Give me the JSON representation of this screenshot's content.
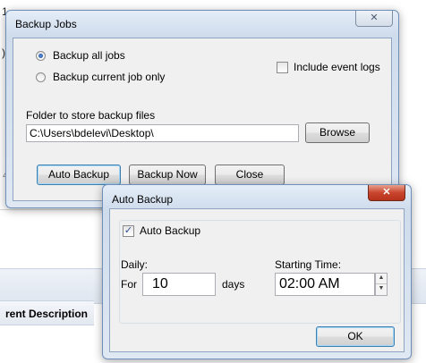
{
  "background": {
    "left_digit": "1",
    "left_paren": ")",
    "left_four": "4",
    "event_header": "rent Description"
  },
  "backup_jobs": {
    "title": "Backup Jobs",
    "close_glyph": "✕",
    "radio_all": "Backup all jobs",
    "radio_all_selected": true,
    "radio_current": "Backup current job only",
    "include_logs_label": "Include event logs",
    "include_logs_checked": false,
    "folder_label": "Folder to store backup files",
    "folder_value": "C:\\Users\\bdelevi\\Desktop\\",
    "browse_label": "Browse",
    "auto_backup_label": "Auto Backup",
    "backup_now_label": "Backup Now",
    "close_label": "Close"
  },
  "auto_backup": {
    "title": "Auto Backup",
    "close_glyph": "✕",
    "checkbox_label": "Auto Backup",
    "checkbox_checked": true,
    "checkbox_glyph": "✓",
    "daily_label": "Daily:",
    "for_label": "For",
    "days_value": "10",
    "days_label": "days",
    "starting_label": "Starting Time:",
    "time_value": "02:00 AM",
    "ok_label": "OK"
  },
  "icons": {
    "spin_up": "▲",
    "spin_down": "▼"
  },
  "colors": {
    "title_bar": "#cfdcec",
    "client_bg": "#f0f0f0",
    "close_red": "#c9452c"
  }
}
